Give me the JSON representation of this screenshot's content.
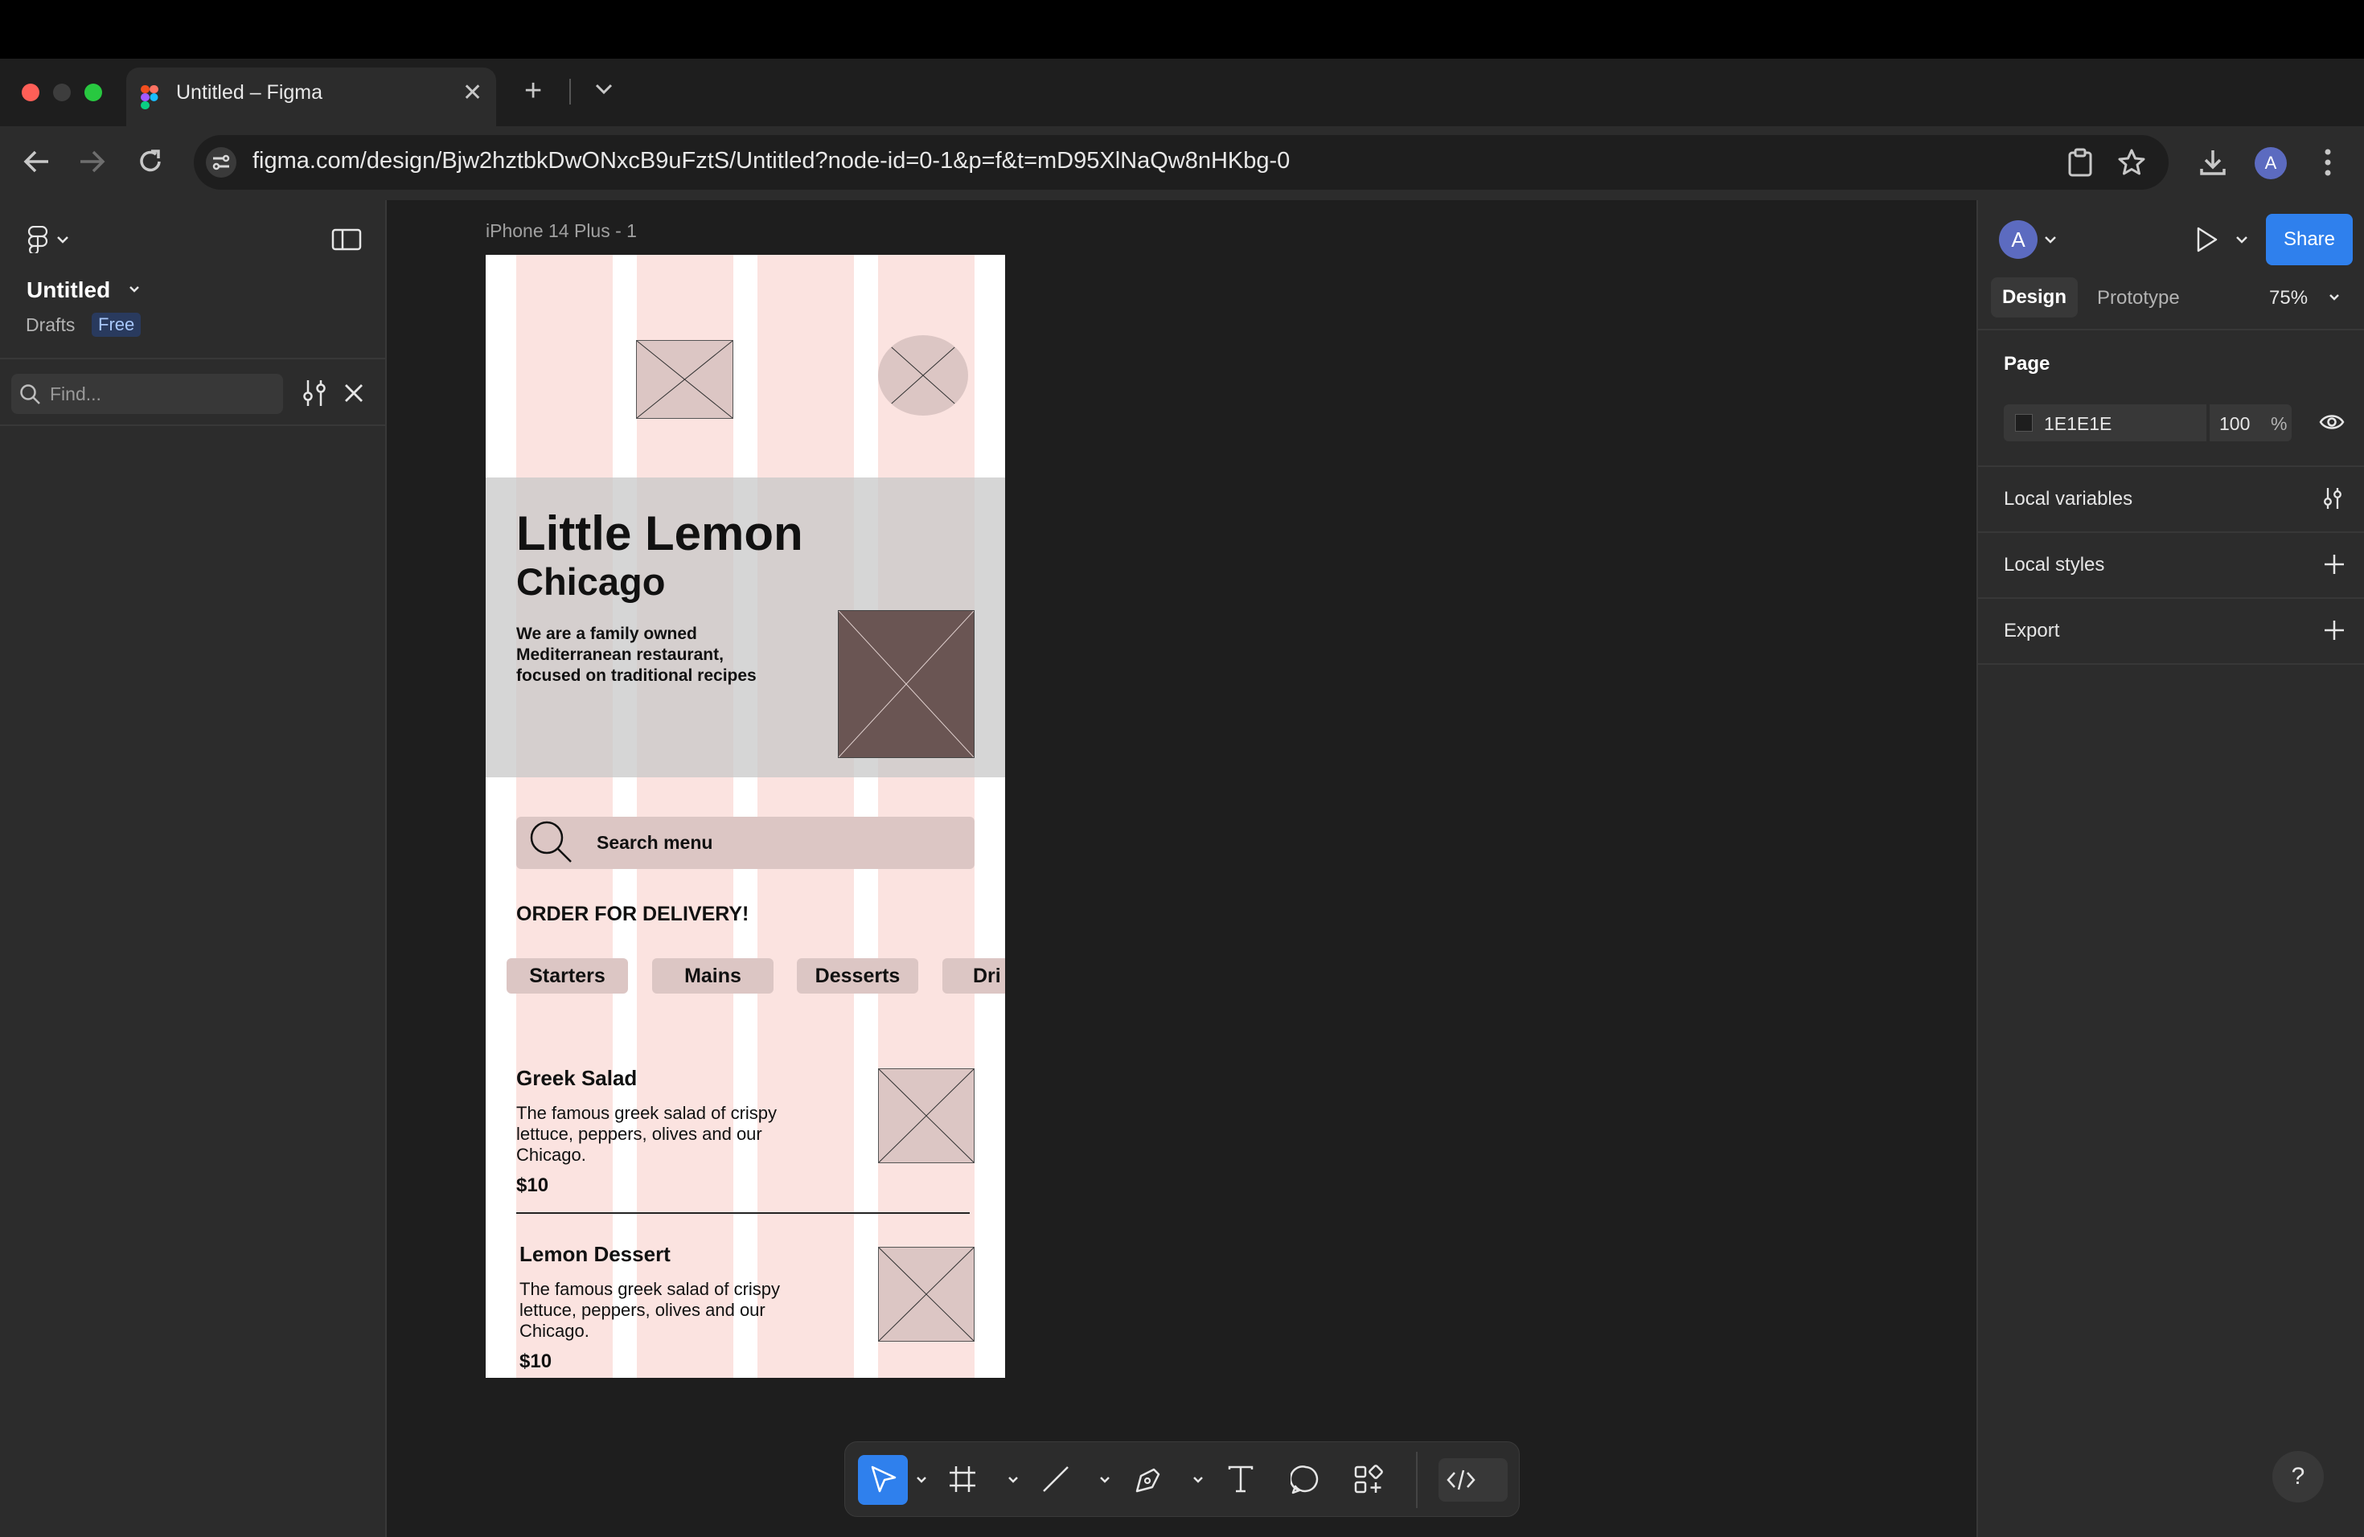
{
  "browser": {
    "tab_title": "Untitled – Figma",
    "url": "figma.com/design/Bjw2hztbkDwONxcB9uFztS/Untitled?node-id=0-1&p=f&t=mD95XlNaQw8nHKbg-0",
    "profile_initial": "A"
  },
  "left_panel": {
    "file_name": "Untitled",
    "location": "Drafts",
    "plan_badge": "Free",
    "search_placeholder": "Find..."
  },
  "canvas": {
    "frame_label": "iPhone 14 Plus - 1"
  },
  "design": {
    "hero_title": "Little Lemon",
    "hero_subtitle": "Chicago",
    "hero_description_1": "We are a family owned",
    "hero_description_2": "Mediterranean restaurant,",
    "hero_description_3": "focused on traditional recipes",
    "search_label": "Search menu",
    "order_heading": "ORDER FOR DELIVERY!",
    "categories": [
      "Starters",
      "Mains",
      "Desserts",
      "Dri"
    ],
    "items": [
      {
        "name": "Greek Salad",
        "desc_1": "The famous greek salad of crispy",
        "desc_2": "lettuce, peppers, olives and our",
        "desc_3": "Chicago.",
        "price": "$10"
      },
      {
        "name": "Lemon Dessert",
        "desc_1": "The famous greek salad of crispy",
        "desc_2": "lettuce, peppers, olives and our",
        "desc_3": "Chicago.",
        "price": "$10"
      }
    ]
  },
  "right_panel": {
    "avatar_initial": "A",
    "share_label": "Share",
    "tab_design": "Design",
    "tab_prototype": "Prototype",
    "zoom": "75%",
    "page_heading": "Page",
    "page_color": "1E1E1E",
    "page_opacity": "100",
    "opacity_unit": "%",
    "local_variables": "Local variables",
    "local_styles": "Local styles",
    "export": "Export",
    "help": "?"
  },
  "colors": {
    "accent": "#2f80ed",
    "frame_column": "#fbe3e0",
    "placeholder": "#dcc6c4",
    "hero_band": "#d9d9d9",
    "page_background": "#1e1e1e"
  }
}
